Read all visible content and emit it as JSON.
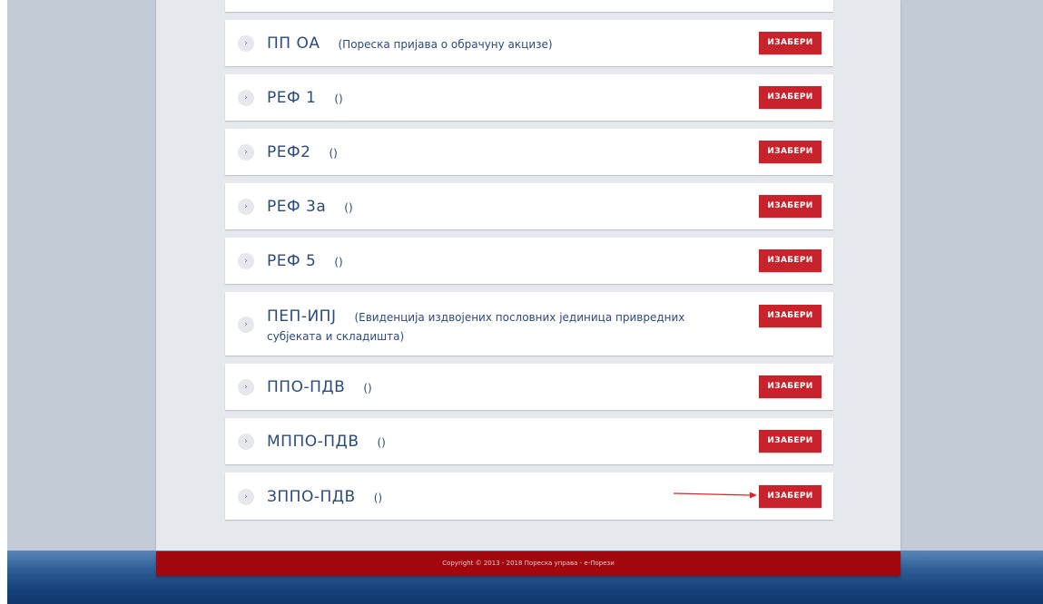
{
  "button_label": "ИЗАБЕРИ",
  "forms": [
    {
      "code": "ПП ОА",
      "desc": "(Пореска пријава о обрачуну акцизе)"
    },
    {
      "code": "РЕФ 1",
      "desc": "()"
    },
    {
      "code": "РЕФ2",
      "desc": "()"
    },
    {
      "code": "РЕФ 3а",
      "desc": "()"
    },
    {
      "code": "РЕФ 5",
      "desc": "()"
    },
    {
      "code": "ПЕП-ИПЈ",
      "desc": "(Евиденција издвојених пословних јединица привредних субјеката и складишта)"
    },
    {
      "code": "ППО-ПДВ",
      "desc": "()"
    },
    {
      "code": "МППО-ПДВ",
      "desc": "()"
    },
    {
      "code": "ЗППО-ПДВ",
      "desc": "()"
    }
  ],
  "footer": {
    "copyright": "Copyright © 2013 - 2018 Пореска управа - е-Порези"
  },
  "colors": {
    "accent_red": "#c8232c",
    "footer_red": "#a2070e",
    "text_blue": "#2b4a80"
  }
}
